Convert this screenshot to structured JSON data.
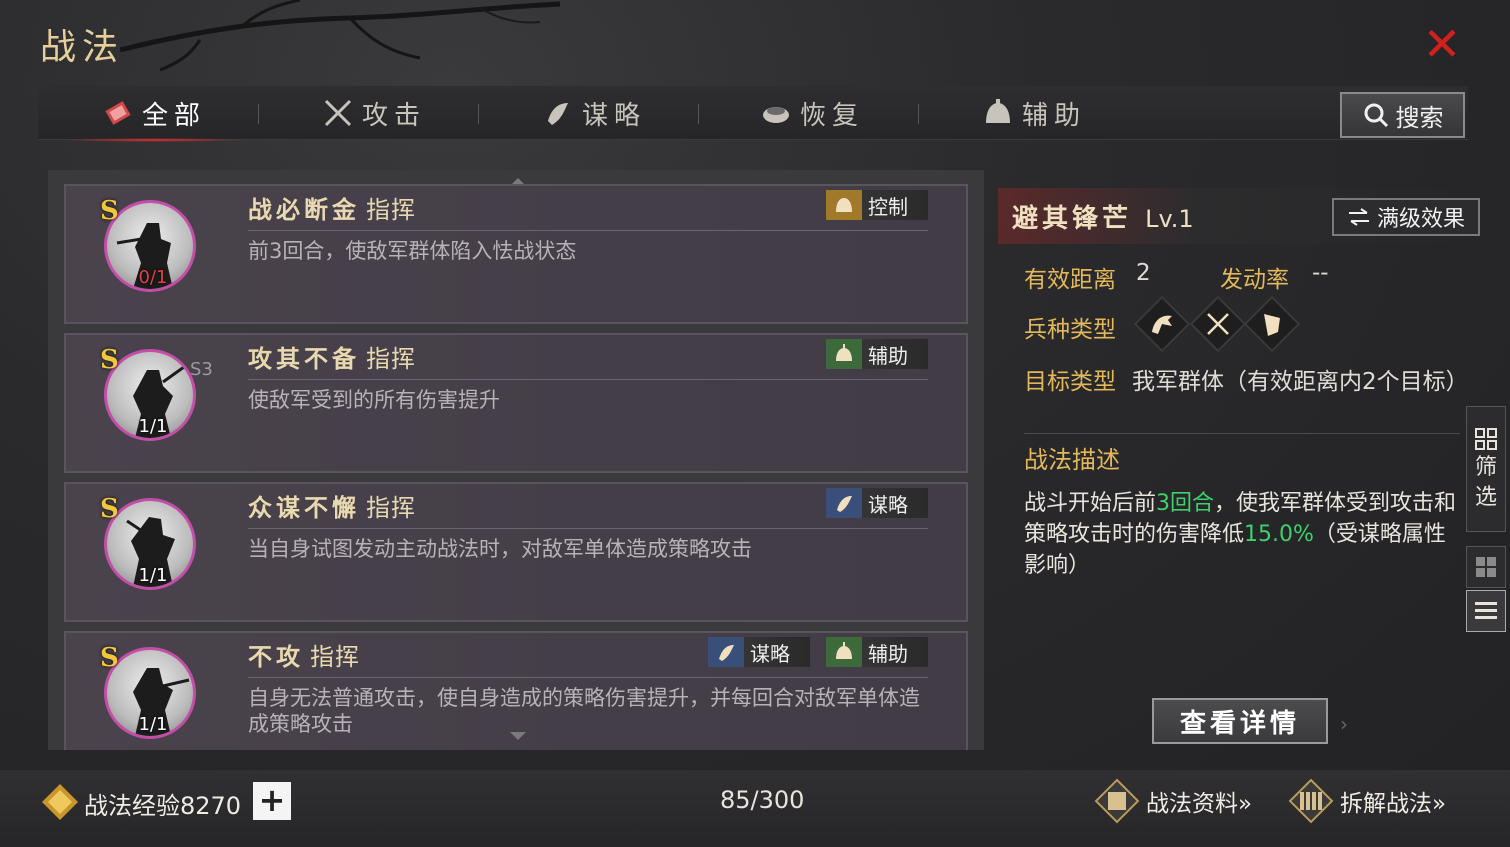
{
  "header": {
    "title": "战法",
    "close_icon": "close-icon"
  },
  "tabs": [
    {
      "label": "全部",
      "icon": "all-icon",
      "active": true
    },
    {
      "label": "攻击",
      "icon": "crossed-swords-icon",
      "active": false
    },
    {
      "label": "谋略",
      "icon": "scroll-icon",
      "active": false
    },
    {
      "label": "恢复",
      "icon": "medicine-bowl-icon",
      "active": false
    },
    {
      "label": "辅助",
      "icon": "helmet-icon",
      "active": false
    }
  ],
  "search": {
    "label": "搜索"
  },
  "tactics": [
    {
      "grade": "S",
      "star": "",
      "count": "0/1",
      "name": "战必断金",
      "kind": "指挥",
      "tags": [
        {
          "label": "控制",
          "type": "ctrl"
        }
      ],
      "desc": "前3回合，使敌军群体陷入怯战状态"
    },
    {
      "grade": "S",
      "star": "S3",
      "count": "1/1",
      "name": "攻其不备",
      "kind": "指挥",
      "tags": [
        {
          "label": "辅助",
          "type": "help"
        }
      ],
      "desc": "使敌军受到的所有伤害提升"
    },
    {
      "grade": "S",
      "star": "",
      "count": "1/1",
      "name": "众谋不懈",
      "kind": "指挥",
      "tags": [
        {
          "label": "谋略",
          "type": "plot"
        }
      ],
      "desc": "当自身试图发动主动战法时，对敌军单体造成策略攻击"
    },
    {
      "grade": "S",
      "star": "",
      "count": "1/1",
      "name": "不攻",
      "kind": "指挥",
      "tags": [
        {
          "label": "谋略",
          "type": "plot"
        },
        {
          "label": "辅助",
          "type": "help"
        }
      ],
      "desc": "自身无法普通攻击，使自身造成的策略伤害提升，并每回合对敌军单体造成策略攻击"
    }
  ],
  "detail": {
    "name": "避其锋芒",
    "level": "Lv.1",
    "max_level_button": "满级效果",
    "range_label": "有效距离",
    "range_value": "2",
    "rate_label": "发动率",
    "rate_value": "--",
    "troop_label": "兵种类型",
    "troop_icons": [
      "cavalry-icon",
      "archer-icon",
      "shield-icon"
    ],
    "target_label": "目标类型",
    "target_value": "我军群体（有效距离内2个目标）",
    "desc_title": "战法描述",
    "desc_pre": "战斗开始后前",
    "desc_hl1": "3回合",
    "desc_mid": "，使我军群体受到攻击和策略攻击时的伤害降低",
    "desc_hl2": "15.0%",
    "desc_post": "（受谋略属性影响）",
    "view_detail_button": "查看详情"
  },
  "side": {
    "filter_label_1": "筛",
    "filter_label_2": "选"
  },
  "bottom": {
    "exp_label": "战法经验8270",
    "plus": "+",
    "capacity": "85/300",
    "info_link": "战法资料»",
    "dismantle_link": "拆解战法»"
  },
  "colors": {
    "accent_gold": "#e2b85a",
    "highlight_green": "#3ed06a",
    "close_red": "#d02020",
    "avatar_ring": "#c34ea8"
  }
}
